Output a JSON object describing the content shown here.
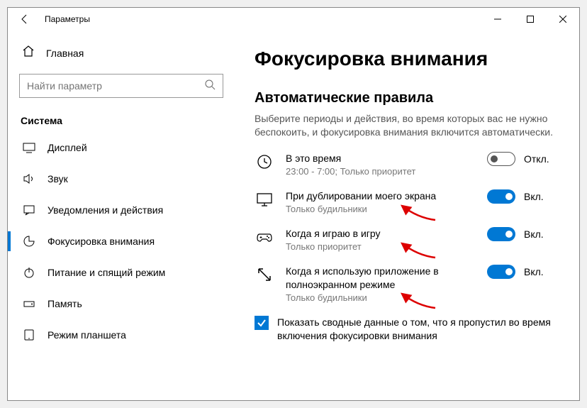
{
  "window": {
    "title": "Параметры"
  },
  "sidebar": {
    "home": "Главная",
    "search_placeholder": "Найти параметр",
    "section": "Система",
    "items": [
      {
        "label": "Дисплей"
      },
      {
        "label": "Звук"
      },
      {
        "label": "Уведомления и действия"
      },
      {
        "label": "Фокусировка внимания"
      },
      {
        "label": "Питание и спящий режим"
      },
      {
        "label": "Память"
      },
      {
        "label": "Режим планшета"
      }
    ]
  },
  "main": {
    "title": "Фокусировка внимания",
    "subheader": "Автоматические правила",
    "description": "Выберите периоды и действия, во время которых вас не нужно беспокоить, и фокусировка внимания включится автоматически.",
    "rules": [
      {
        "title": "В это время",
        "sub": "23:00 - 7:00; Только приоритет",
        "on": false,
        "state": "Откл."
      },
      {
        "title": "При дублировании моего экрана",
        "sub": "Только будильники",
        "on": true,
        "state": "Вкл."
      },
      {
        "title": "Когда я играю в игру",
        "sub": "Только приоритет",
        "on": true,
        "state": "Вкл."
      },
      {
        "title": "Когда я использую приложение в полноэкранном режиме",
        "sub": "Только будильники",
        "on": true,
        "state": "Вкл."
      }
    ],
    "checkbox_label": "Показать сводные данные о том, что я пропустил во время включения фокусировки внимания"
  }
}
